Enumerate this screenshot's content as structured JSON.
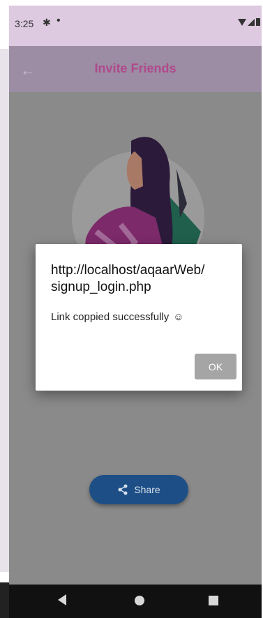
{
  "status_bar": {
    "time": "3:25",
    "gear_icon": "gear-icon",
    "dot_icon": "notification-dot-icon",
    "status_icons": [
      "wifi-icon",
      "cellular-icon",
      "battery-icon"
    ]
  },
  "app_bar": {
    "title": "Invite Friends",
    "back_icon": "back-arrow-icon"
  },
  "content": {
    "share_label": "Share",
    "share_icon": "share-icon"
  },
  "dialog": {
    "title": "http://localhost/aqaarWeb/\nsignup_login.php",
    "message": "Link coppied successfully",
    "emoji": "☺",
    "ok_label": "OK"
  },
  "colors": {
    "status_bar": "#ddc9e0",
    "app_bar": "#9c8ca4",
    "title": "#b04a8c",
    "scrim_background": "#8a8a8a",
    "share_button": "#1d4f86",
    "ok_button": "#a5a5a5"
  }
}
